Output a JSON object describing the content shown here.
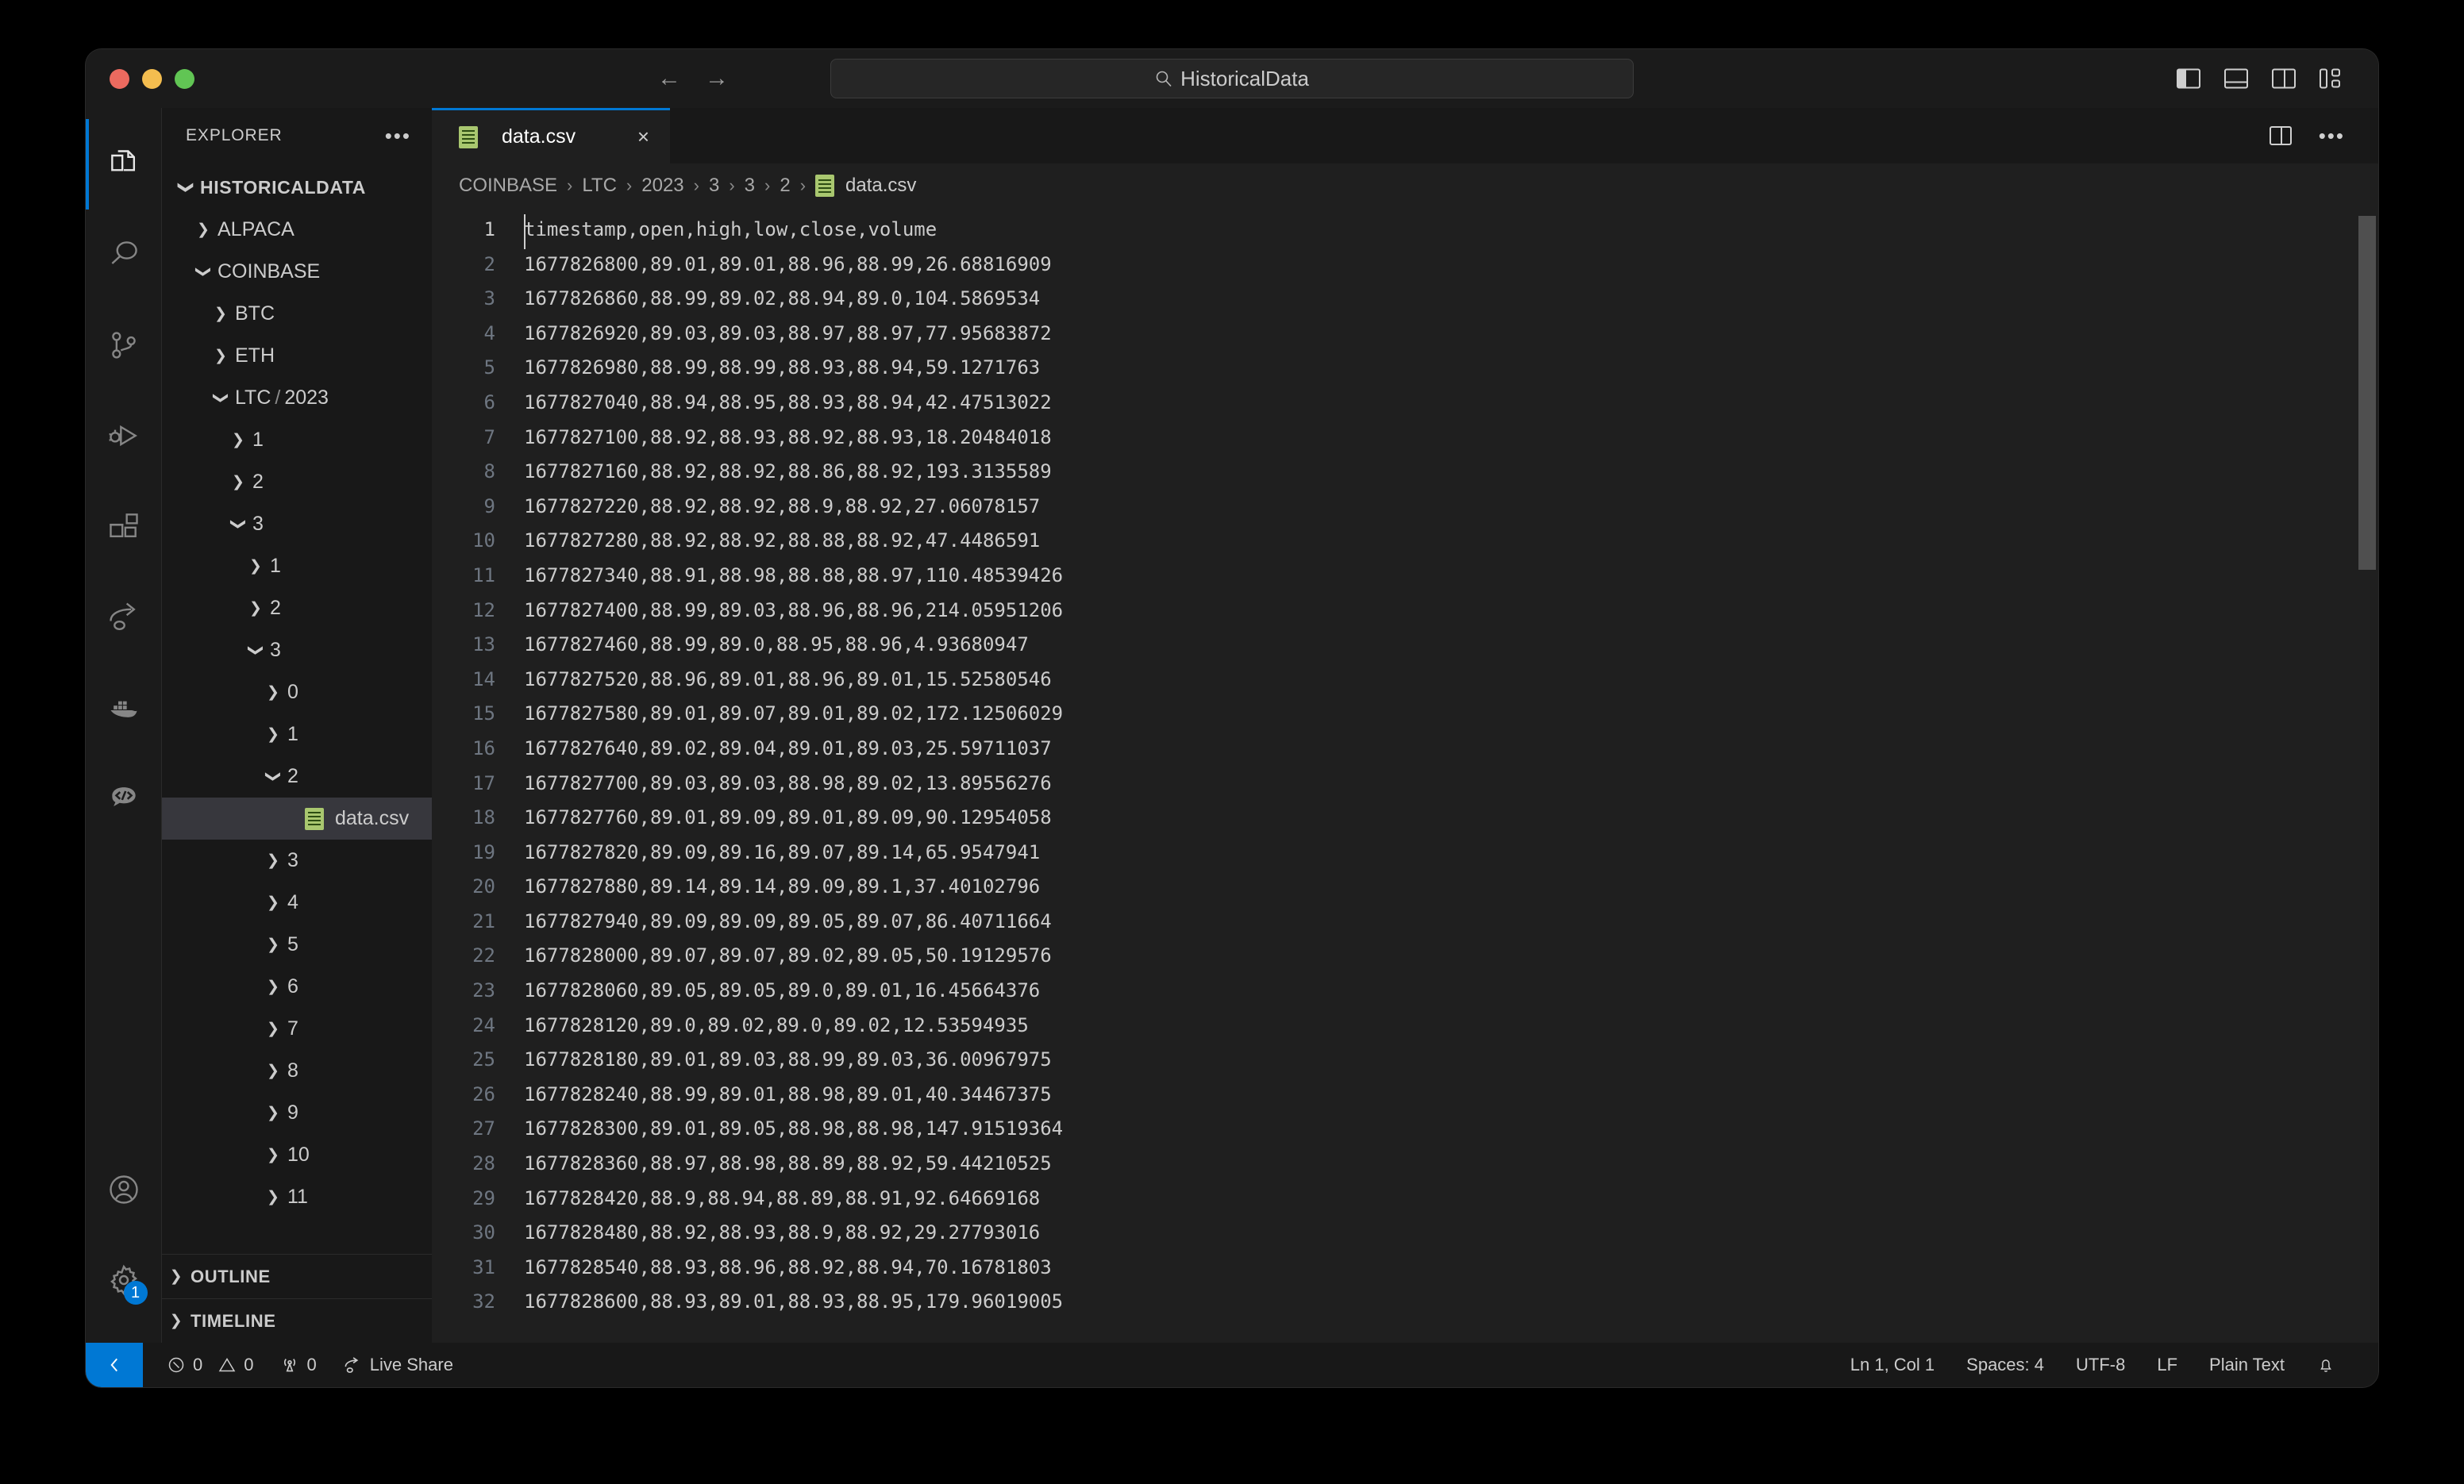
{
  "window": {
    "traffic_lights": [
      "close",
      "minimize",
      "maximize"
    ],
    "search_value": "HistoricalData",
    "search_icon": "search-icon",
    "nav_back": "←",
    "nav_forward": "→"
  },
  "activity_bar": {
    "items": [
      {
        "name": "explorer",
        "icon": "files-icon",
        "active": true
      },
      {
        "name": "search",
        "icon": "search-icon",
        "active": false
      },
      {
        "name": "source-control",
        "icon": "source-control-icon",
        "active": false
      },
      {
        "name": "run-and-debug",
        "icon": "run-debug-icon",
        "active": false
      },
      {
        "name": "extensions",
        "icon": "extensions-icon",
        "active": false
      },
      {
        "name": "live-share",
        "icon": "live-share-icon",
        "active": false
      },
      {
        "name": "docker",
        "icon": "docker-icon",
        "active": false
      },
      {
        "name": "remote-explorer",
        "icon": "remote-icon",
        "active": false
      }
    ],
    "bottom": [
      {
        "name": "accounts",
        "icon": "account-icon"
      },
      {
        "name": "settings",
        "icon": "gear-icon",
        "badge": "1"
      }
    ]
  },
  "sidebar": {
    "title": "EXPLORER",
    "more_actions": "•••",
    "tree": [
      {
        "label": "HISTORICALDATA",
        "depth": 0,
        "type": "root",
        "expanded": true
      },
      {
        "label": "ALPACA",
        "depth": 1,
        "type": "folder",
        "expanded": false
      },
      {
        "label": "COINBASE",
        "depth": 1,
        "type": "folder",
        "expanded": true
      },
      {
        "label": "BTC",
        "depth": 2,
        "type": "folder",
        "expanded": false
      },
      {
        "label": "ETH",
        "depth": 2,
        "type": "folder",
        "expanded": false
      },
      {
        "label": "LTC",
        "sublabel": "2023",
        "depth": 2,
        "type": "folder-compact",
        "expanded": true
      },
      {
        "label": "1",
        "depth": 3,
        "type": "folder",
        "expanded": false
      },
      {
        "label": "2",
        "depth": 3,
        "type": "folder",
        "expanded": false
      },
      {
        "label": "3",
        "depth": 3,
        "type": "folder",
        "expanded": true
      },
      {
        "label": "1",
        "depth": 4,
        "type": "folder",
        "expanded": false
      },
      {
        "label": "2",
        "depth": 4,
        "type": "folder",
        "expanded": false
      },
      {
        "label": "3",
        "depth": 4,
        "type": "folder",
        "expanded": true
      },
      {
        "label": "0",
        "depth": 5,
        "type": "folder",
        "expanded": false
      },
      {
        "label": "1",
        "depth": 5,
        "type": "folder",
        "expanded": false
      },
      {
        "label": "2",
        "depth": 5,
        "type": "folder",
        "expanded": true
      },
      {
        "label": "data.csv",
        "depth": 6,
        "type": "file",
        "selected": true
      },
      {
        "label": "3",
        "depth": 5,
        "type": "folder",
        "expanded": false
      },
      {
        "label": "4",
        "depth": 5,
        "type": "folder",
        "expanded": false
      },
      {
        "label": "5",
        "depth": 5,
        "type": "folder",
        "expanded": false
      },
      {
        "label": "6",
        "depth": 5,
        "type": "folder",
        "expanded": false
      },
      {
        "label": "7",
        "depth": 5,
        "type": "folder",
        "expanded": false
      },
      {
        "label": "8",
        "depth": 5,
        "type": "folder",
        "expanded": false
      },
      {
        "label": "9",
        "depth": 5,
        "type": "folder",
        "expanded": false
      },
      {
        "label": "10",
        "depth": 5,
        "type": "folder",
        "expanded": false
      },
      {
        "label": "11",
        "depth": 5,
        "type": "folder",
        "expanded": false
      }
    ],
    "sections": [
      {
        "label": "OUTLINE",
        "expanded": false
      },
      {
        "label": "TIMELINE",
        "expanded": false
      }
    ]
  },
  "editor": {
    "tab": {
      "label": "data.csv",
      "icon": "csv-file-icon",
      "close": "×",
      "active": true
    },
    "actions": {
      "split_editor": "split-editor-icon",
      "more": "•••"
    },
    "breadcrumb": [
      "COINBASE",
      "LTC",
      "2023",
      "3",
      "3",
      "2",
      "data.csv"
    ],
    "breadcrumb_separator": "›",
    "lines": [
      "timestamp,open,high,low,close,volume",
      "1677826800,89.01,89.01,88.96,88.99,26.68816909",
      "1677826860,88.99,89.02,88.94,89.0,104.5869534",
      "1677826920,89.03,89.03,88.97,88.97,77.95683872",
      "1677826980,88.99,88.99,88.93,88.94,59.1271763",
      "1677827040,88.94,88.95,88.93,88.94,42.47513022",
      "1677827100,88.92,88.93,88.92,88.93,18.20484018",
      "1677827160,88.92,88.92,88.86,88.92,193.3135589",
      "1677827220,88.92,88.92,88.9,88.92,27.06078157",
      "1677827280,88.92,88.92,88.88,88.92,47.4486591",
      "1677827340,88.91,88.98,88.88,88.97,110.48539426",
      "1677827400,88.99,89.03,88.96,88.96,214.05951206",
      "1677827460,88.99,89.0,88.95,88.96,4.93680947",
      "1677827520,88.96,89.01,88.96,89.01,15.52580546",
      "1677827580,89.01,89.07,89.01,89.02,172.12506029",
      "1677827640,89.02,89.04,89.01,89.03,25.59711037",
      "1677827700,89.03,89.03,88.98,89.02,13.89556276",
      "1677827760,89.01,89.09,89.01,89.09,90.12954058",
      "1677827820,89.09,89.16,89.07,89.14,65.9547941",
      "1677827880,89.14,89.14,89.09,89.1,37.40102796",
      "1677827940,89.09,89.09,89.05,89.07,86.40711664",
      "1677828000,89.07,89.07,89.02,89.05,50.19129576",
      "1677828060,89.05,89.05,89.0,89.01,16.45664376",
      "1677828120,89.0,89.02,89.0,89.02,12.53594935",
      "1677828180,89.01,89.03,88.99,89.03,36.00967975",
      "1677828240,88.99,89.01,88.98,89.01,40.34467375",
      "1677828300,89.01,89.05,88.98,88.98,147.91519364",
      "1677828360,88.97,88.98,88.89,88.92,59.44210525",
      "1677828420,88.9,88.94,88.89,88.91,92.64669168",
      "1677828480,88.92,88.93,88.9,88.92,29.27793016",
      "1677828540,88.93,88.96,88.92,88.94,70.16781803",
      "1677828600,88.93,89.01,88.93,88.95,179.96019005"
    ]
  },
  "status_bar": {
    "remote_icon": "remote-indicator-icon",
    "left": [
      {
        "name": "errors",
        "icon": "error-icon",
        "value": "0"
      },
      {
        "name": "warnings",
        "icon": "warning-icon",
        "value": "0"
      },
      {
        "name": "ports",
        "icon": "radio-tower-icon",
        "value": "0"
      },
      {
        "name": "live-share",
        "icon": "live-share-icon",
        "value": "Live Share"
      }
    ],
    "right": [
      {
        "name": "cursor-position",
        "value": "Ln 1, Col 1"
      },
      {
        "name": "indentation",
        "value": "Spaces: 4"
      },
      {
        "name": "encoding",
        "value": "UTF-8"
      },
      {
        "name": "eol",
        "value": "LF"
      },
      {
        "name": "language-mode",
        "value": "Plain Text"
      },
      {
        "name": "notifications",
        "icon": "bell-icon",
        "value": ""
      }
    ]
  },
  "colors": {
    "accent": "#0078d4",
    "editor_bg": "#1f1f1f",
    "sidebar_bg": "#181818",
    "selection": "#37373d",
    "csv_green": "#a9c76f"
  }
}
